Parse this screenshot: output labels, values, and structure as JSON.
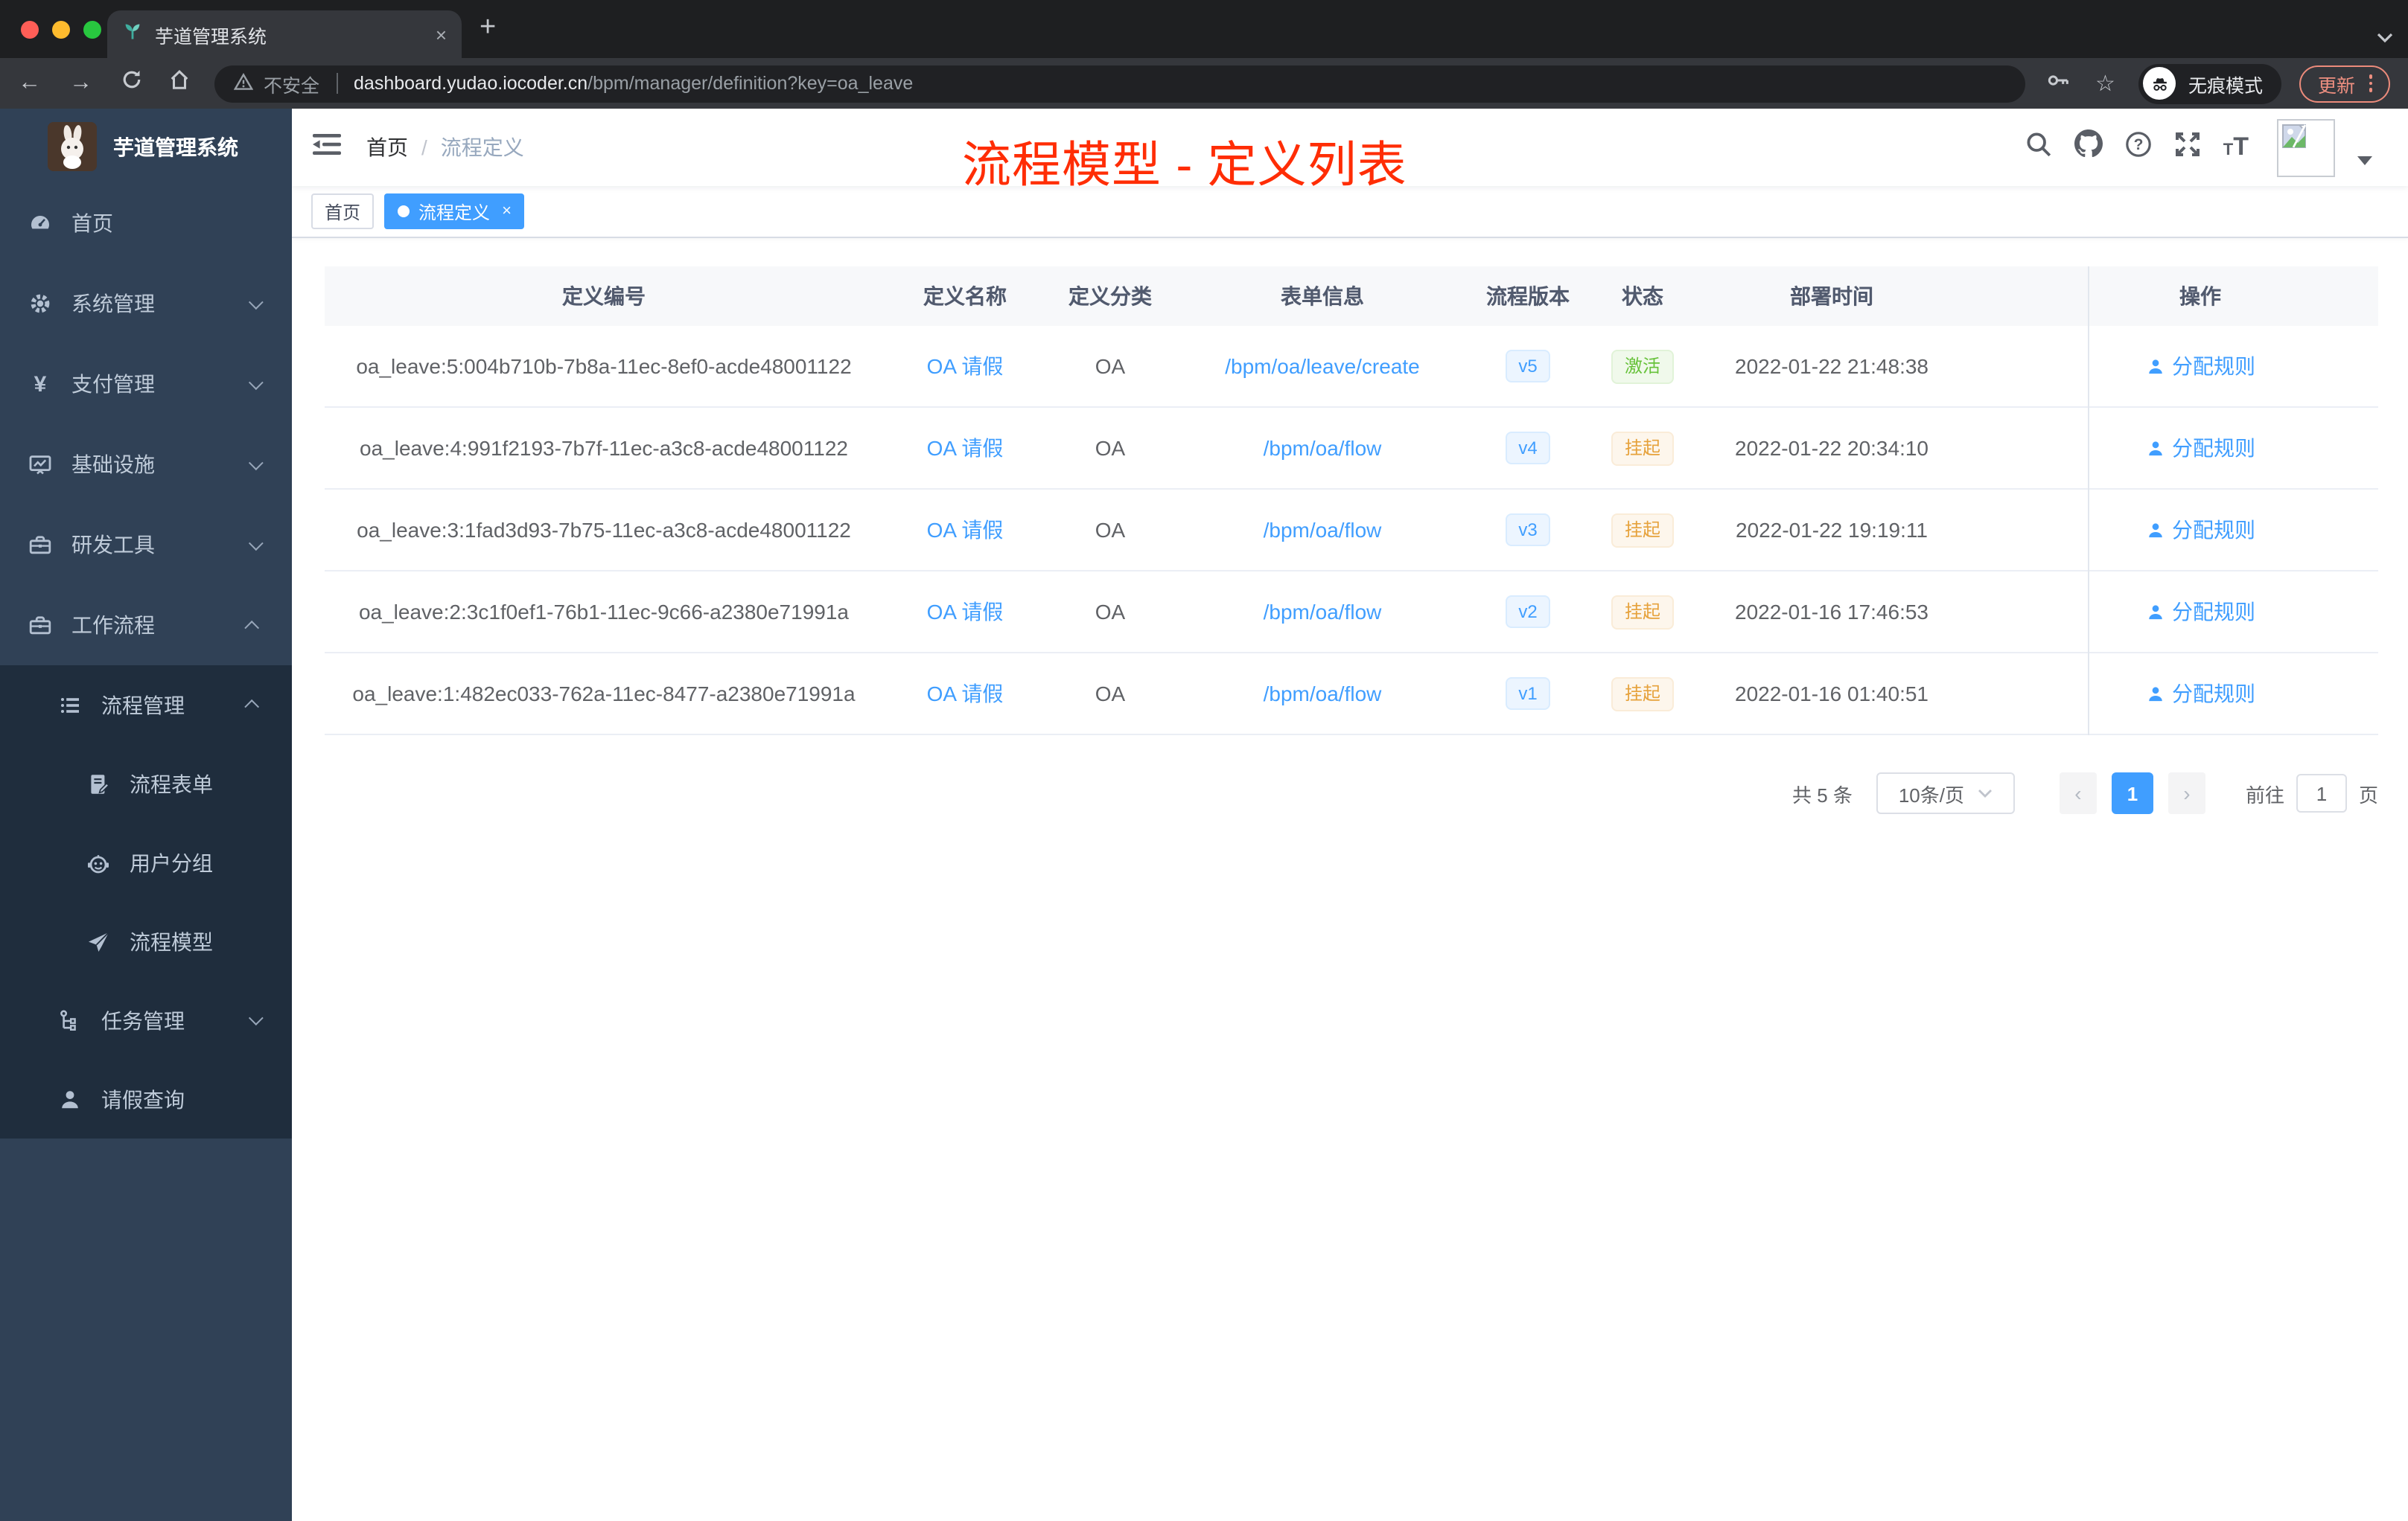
{
  "browser": {
    "tab": {
      "title": "芋道管理系统",
      "close_glyph": "×",
      "new_tab_glyph": "+"
    },
    "toolbar": {
      "back_glyph": "←",
      "forward_glyph": "→",
      "security_label": "不安全",
      "url_domain": "dashboard.yudao.iocoder.cn",
      "url_path": "/bpm/manager/definition?key=oa_leave",
      "incognito_label": "无痕模式",
      "update_label": "更新",
      "star_glyph": "☆"
    }
  },
  "sidebar": {
    "logo_title": "芋道管理系统",
    "items": [
      {
        "label": "首页"
      },
      {
        "label": "系统管理"
      },
      {
        "label": "支付管理"
      },
      {
        "label": "基础设施"
      },
      {
        "label": "研发工具"
      },
      {
        "label": "工作流程"
      },
      {
        "label": "流程管理"
      },
      {
        "label": "流程表单"
      },
      {
        "label": "用户分组"
      },
      {
        "label": "流程模型"
      },
      {
        "label": "任务管理"
      },
      {
        "label": "请假查询"
      }
    ]
  },
  "header": {
    "breadcrumb_home": "首页",
    "breadcrumb_separator": "/",
    "breadcrumb_current": "流程定义",
    "annotation": "流程模型 - 定义列表"
  },
  "tags": {
    "home": "首页",
    "active": "流程定义",
    "close_glyph": "×"
  },
  "table": {
    "columns": [
      "定义编号",
      "定义名称",
      "定义分类",
      "表单信息",
      "流程版本",
      "状态",
      "部署时间",
      "操作"
    ],
    "rows": [
      {
        "id": "oa_leave:5:004b710b-7b8a-11ec-8ef0-acde48001122",
        "name": "OA 请假",
        "category": "OA",
        "form": "/bpm/oa/leave/create",
        "version": "v5",
        "status": "激活",
        "deployed": "2022-01-22 21:48:38",
        "action": "分配规则"
      },
      {
        "id": "oa_leave:4:991f2193-7b7f-11ec-a3c8-acde48001122",
        "name": "OA 请假",
        "category": "OA",
        "form": "/bpm/oa/flow",
        "version": "v4",
        "status": "挂起",
        "deployed": "2022-01-22 20:34:10",
        "action": "分配规则"
      },
      {
        "id": "oa_leave:3:1fad3d93-7b75-11ec-a3c8-acde48001122",
        "name": "OA 请假",
        "category": "OA",
        "form": "/bpm/oa/flow",
        "version": "v3",
        "status": "挂起",
        "deployed": "2022-01-22 19:19:11",
        "action": "分配规则"
      },
      {
        "id": "oa_leave:2:3c1f0ef1-76b1-11ec-9c66-a2380e71991a",
        "name": "OA 请假",
        "category": "OA",
        "form": "/bpm/oa/flow",
        "version": "v2",
        "status": "挂起",
        "deployed": "2022-01-16 17:46:53",
        "action": "分配规则"
      },
      {
        "id": "oa_leave:1:482ec033-762a-11ec-8477-a2380e71991a",
        "name": "OA 请假",
        "category": "OA",
        "form": "/bpm/oa/flow",
        "version": "v1",
        "status": "挂起",
        "deployed": "2022-01-16 01:40:51",
        "action": "分配规则"
      }
    ]
  },
  "pagination": {
    "total": "共 5 条",
    "page_size": "10条/页",
    "prev_glyph": "‹",
    "page": "1",
    "next_glyph": "›",
    "goto_label": "前往",
    "goto_value": "1",
    "unit_label": "页"
  },
  "colors": {
    "accent": "#409eff",
    "annotation_red": "#ff2d05",
    "success_green": "#67c23a",
    "warning_orange": "#e6a23c",
    "sidebar_bg": "#304156",
    "sidebar_submenu_bg": "#1f2d3d"
  }
}
